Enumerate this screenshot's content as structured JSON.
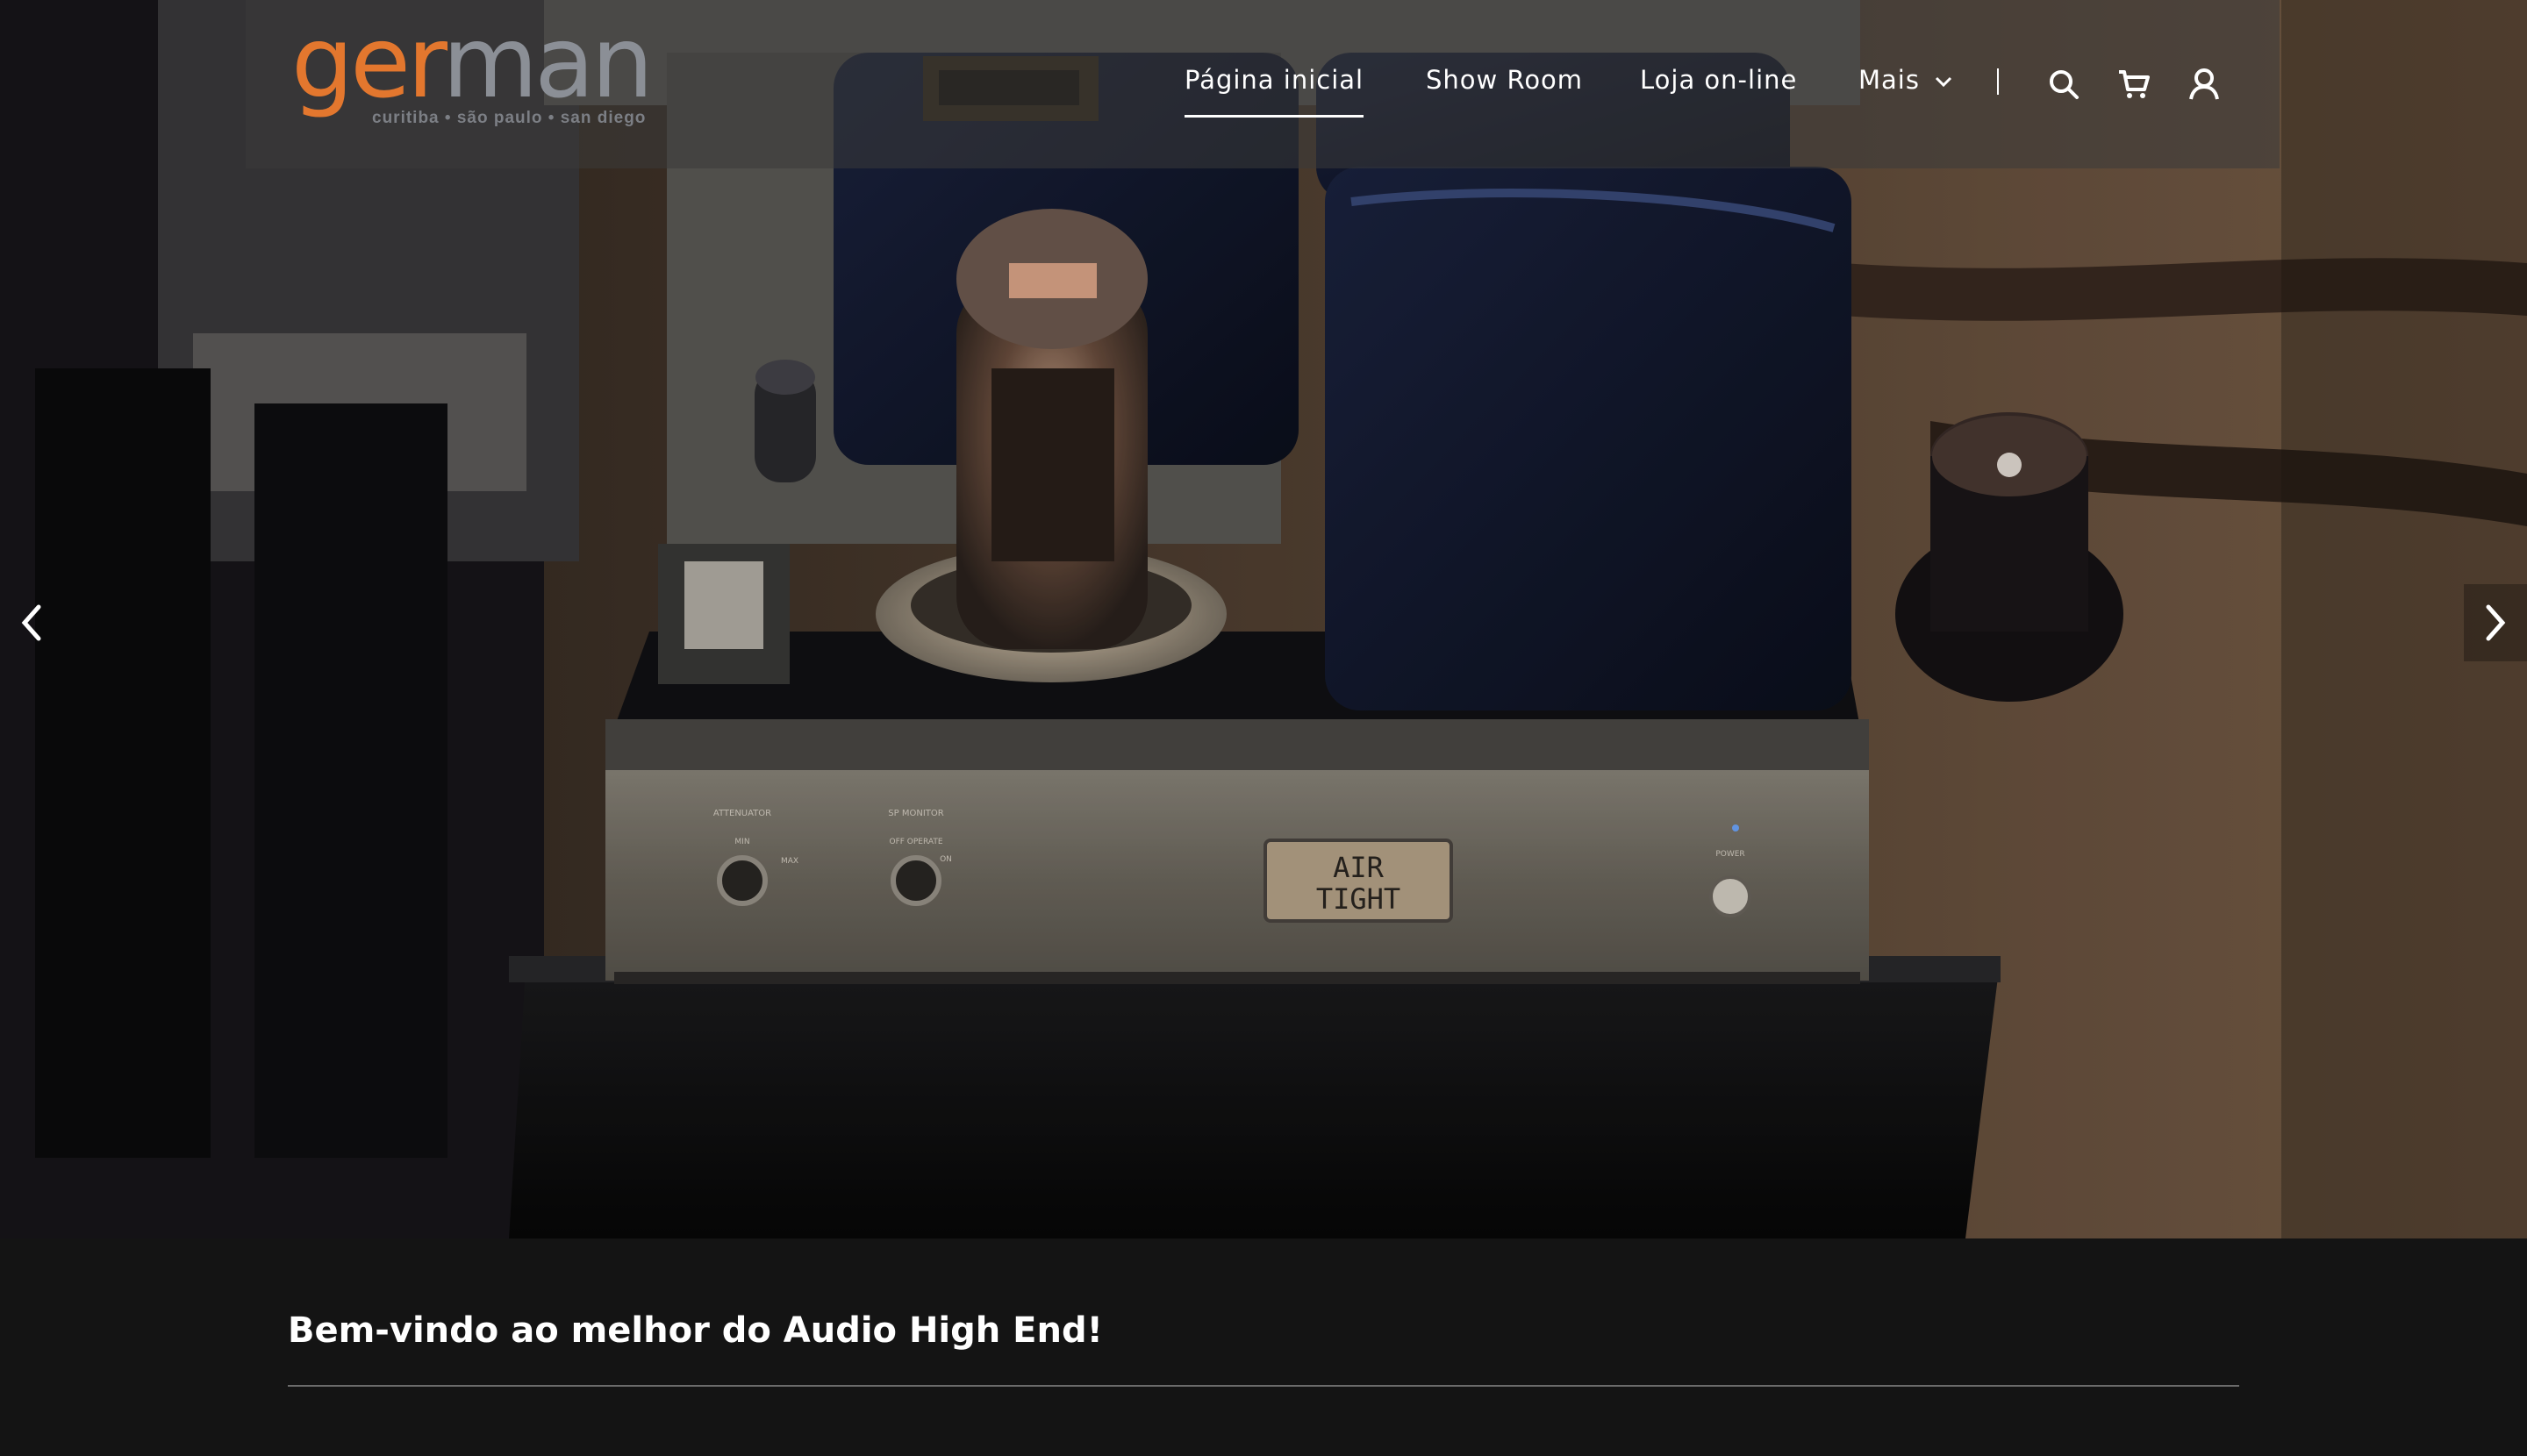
{
  "brand": {
    "logo_part1": "ger",
    "logo_part2": "man",
    "tagline": "curitiba • são paulo • san diego",
    "accent_color": "#e3772e"
  },
  "nav": {
    "items": [
      {
        "label": "Página inicial",
        "active": true
      },
      {
        "label": "Show Room",
        "active": false
      },
      {
        "label": "Loja on-line",
        "active": false
      },
      {
        "label": "Mais",
        "active": false
      }
    ],
    "icons": [
      "search-icon",
      "cart-icon",
      "user-icon"
    ]
  },
  "hero": {
    "amp_badge_line1": "AIR",
    "amp_badge_line2": "TIGHT",
    "knob_labels": [
      "ATTENUATOR",
      "MIN",
      "MAX",
      "SP MONITOR",
      "OFF OPERATE",
      "ON",
      "POWER"
    ],
    "prev_icon": "chevron-left-icon",
    "next_icon": "chevron-right-icon"
  },
  "content": {
    "heading": "Bem-vindo ao melhor do Audio High End!"
  }
}
